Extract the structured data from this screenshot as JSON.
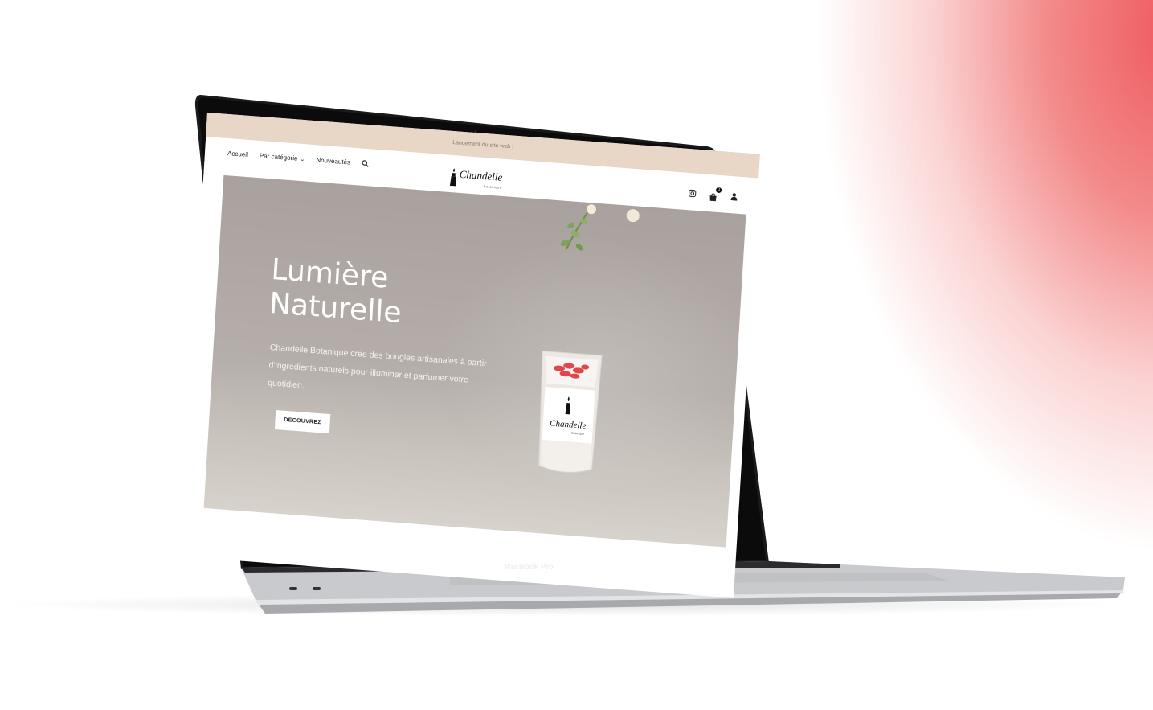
{
  "device": {
    "brand_label": "MacBook Pro"
  },
  "site": {
    "announcement": "Lancement du site web !",
    "nav": {
      "items": [
        {
          "label": "Accueil"
        },
        {
          "label": "Par catégorie"
        },
        {
          "label": "Nouveautés"
        }
      ]
    },
    "logo": {
      "name": "Chandelle",
      "tagline": "Botanique"
    },
    "cart_count": "0",
    "hero": {
      "title_line1": "Lumière",
      "title_line2": "Naturelle",
      "description": "Chandelle Botanique crée des bougies artisanales à partir d'ingrédients naturels pour illuminer et parfumer votre quotidien.",
      "cta_label": "DÉCOUVREZ",
      "jar_label": "Chandelle",
      "jar_sub": "Botanique"
    }
  },
  "colors": {
    "topbar": "#e8d6c6",
    "hero_bg": "#b0a8a4",
    "accent_gradient": "#ef5a5e"
  }
}
